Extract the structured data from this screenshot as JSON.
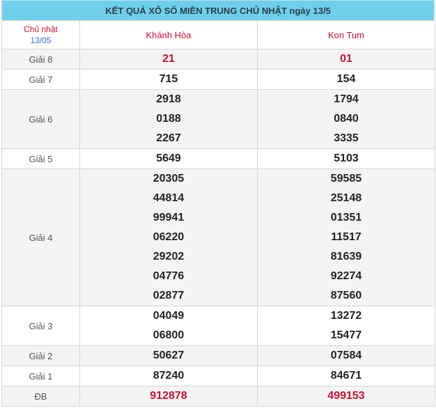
{
  "title": "KẾT QUẢ XỔ SỐ MIỀN TRUNG CHỦ NHẬT ngày 13/5",
  "header": {
    "day": "Chủ nhật",
    "date": "13/05",
    "province_1": "Khánh Hòa",
    "province_2": "Kon Tum"
  },
  "prizes": {
    "g8": {
      "label": "Giải 8",
      "p1": [
        "21"
      ],
      "p2": [
        "01"
      ]
    },
    "g7": {
      "label": "Giải 7",
      "p1": [
        "715"
      ],
      "p2": [
        "154"
      ]
    },
    "g6": {
      "label": "Giải 6",
      "p1": [
        "2918",
        "0188",
        "2267"
      ],
      "p2": [
        "1794",
        "0840",
        "3335"
      ]
    },
    "g5": {
      "label": "Giải 5",
      "p1": [
        "5649"
      ],
      "p2": [
        "5103"
      ]
    },
    "g4": {
      "label": "Giải 4",
      "p1": [
        "20305",
        "44814",
        "99941",
        "06220",
        "29202",
        "04776",
        "02877"
      ],
      "p2": [
        "59585",
        "25148",
        "01351",
        "11517",
        "81639",
        "92274",
        "87560"
      ]
    },
    "g3": {
      "label": "Giải 3",
      "p1": [
        "04049",
        "06800"
      ],
      "p2": [
        "13272",
        "15477"
      ]
    },
    "g2": {
      "label": "Giải 2",
      "p1": [
        "50627"
      ],
      "p2": [
        "07584"
      ]
    },
    "g1": {
      "label": "Giải 1",
      "p1": [
        "87240"
      ],
      "p2": [
        "84671"
      ]
    },
    "db": {
      "label": "ĐB",
      "p1": [
        "912878"
      ],
      "p2": [
        "499153"
      ]
    }
  },
  "colors": {
    "title_bg": "#6fd0ec",
    "accent_red": "#c8102e",
    "date_blue": "#3b6fd6",
    "row_gray": "#f4f4f4"
  }
}
